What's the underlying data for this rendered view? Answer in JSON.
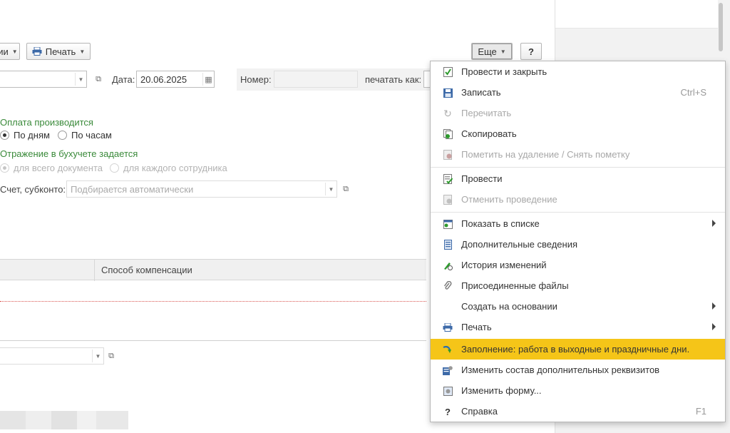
{
  "toolbar": {
    "truncated_label": "ии",
    "print_label": "Печать",
    "more_label": "Еще",
    "help_label": "?"
  },
  "form": {
    "date_label": "Дата:",
    "date_value": "20.06.2025",
    "number_label": "Номер:",
    "number_value": "",
    "print_as_label": "печатать как:",
    "payment_heading": "Оплата производится",
    "payment_options": [
      "По дням",
      "По часам"
    ],
    "accounting_heading": "Отражение в бухучете задается",
    "accounting_options": [
      "для всего документа",
      "для каждого сотрудника"
    ],
    "account_label": "Счет, субконто:",
    "account_placeholder": "Подбирается автоматически",
    "table_column": "Способ компенсации"
  },
  "menu": {
    "items": [
      {
        "label": "Провести и закрыть",
        "shortcut": "",
        "icon": "post-close-icon",
        "disabled": false
      },
      {
        "label": "Записать",
        "shortcut": "Ctrl+S",
        "icon": "save-icon",
        "disabled": false
      },
      {
        "label": "Перечитать",
        "shortcut": "",
        "icon": "reread-icon",
        "disabled": true
      },
      {
        "label": "Скопировать",
        "shortcut": "",
        "icon": "copy-icon",
        "disabled": false
      },
      {
        "label": "Пометить на удаление / Снять пометку",
        "shortcut": "",
        "icon": "mark-delete-icon",
        "disabled": true
      },
      {
        "label": "Провести",
        "shortcut": "",
        "icon": "post-icon",
        "disabled": false
      },
      {
        "label": "Отменить проведение",
        "shortcut": "",
        "icon": "unpost-icon",
        "disabled": true
      },
      {
        "label": "Показать в списке",
        "shortcut": "",
        "icon": "show-in-list-icon",
        "disabled": false,
        "submenu": true
      },
      {
        "label": "Дополнительные сведения",
        "shortcut": "",
        "icon": "additional-info-icon",
        "disabled": false
      },
      {
        "label": "История изменений",
        "shortcut": "",
        "icon": "history-icon",
        "disabled": false
      },
      {
        "label": "Присоединенные файлы",
        "shortcut": "",
        "icon": "paperclip-icon",
        "disabled": false
      },
      {
        "label": "Создать на основании",
        "shortcut": "",
        "icon": "",
        "disabled": false,
        "submenu": true
      },
      {
        "label": "Печать",
        "shortcut": "",
        "icon": "printer-icon",
        "disabled": false,
        "submenu": true
      },
      {
        "label": "Заполнение: работа в выходные и праздничные дни.",
        "shortcut": "",
        "icon": "fill-arrow-icon",
        "disabled": false,
        "highlighted": true
      },
      {
        "label": "Изменить состав дополнительных реквизитов",
        "shortcut": "",
        "icon": "edit-attributes-icon",
        "disabled": false
      },
      {
        "label": "Изменить форму...",
        "shortcut": "",
        "icon": "edit-form-icon",
        "disabled": false
      },
      {
        "label": "Справка",
        "shortcut": "F1",
        "icon": "help-icon",
        "disabled": false
      }
    ]
  },
  "colors": {
    "highlight": "#f5c518",
    "green_heading": "#3a8a3a"
  }
}
